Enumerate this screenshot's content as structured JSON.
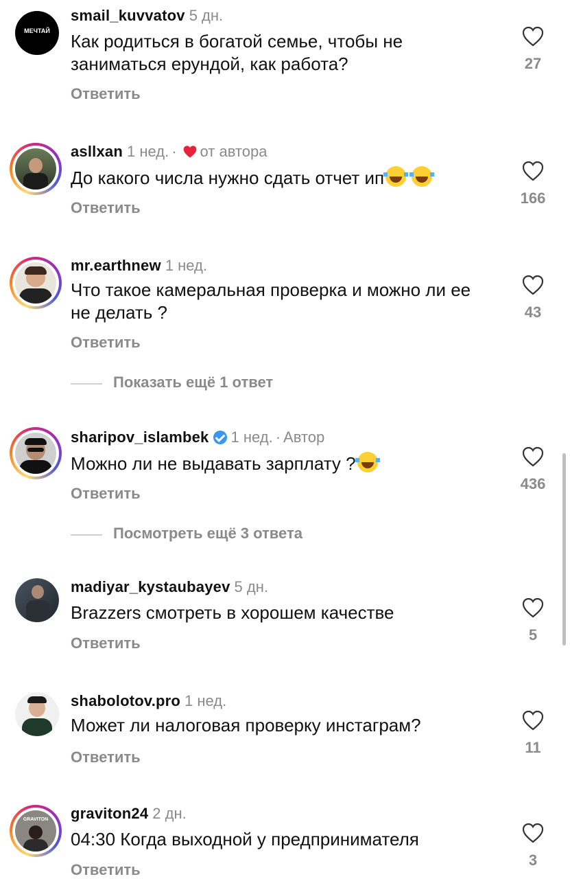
{
  "reply_label": "Ответить",
  "comments": [
    {
      "username": "smail_kuvvatov",
      "time": "5 дн.",
      "text": "Как родиться в богатой семье, чтобы не заниматься ерундой, как работа?",
      "likes": "27",
      "avatar_text": "МЕЧТАЙ"
    },
    {
      "username": "asllxan",
      "time": "1 нед.",
      "badge": "от автора",
      "text": "До какого числа нужно сдать отчет ип",
      "likes": "166"
    },
    {
      "username": "mr.earthnew",
      "time": "1 нед.",
      "text": "Что такое камеральная проверка и можно ли ее не делать ?",
      "likes": "43"
    },
    {
      "username": "sharipov_islambek",
      "time": "1 нед.",
      "badge": "Автор",
      "text": "Можно ли не выдавать зарплату ?",
      "likes": "436"
    },
    {
      "username": "madiyar_kystaubayev",
      "time": "5 дн.",
      "text": "Brazzers смотреть в хорошем качестве",
      "likes": "5"
    },
    {
      "username": "shabolotov.pro",
      "time": "1 нед.",
      "text": "Может ли налоговая проверку инстаграм?",
      "likes": "11"
    },
    {
      "username": "graviton24",
      "time": "2 дн.",
      "text": "04:30 Когда выходной у предпринимателя",
      "likes": "3",
      "avatar_text": "GRAVITON"
    }
  ],
  "more_replies": [
    {
      "label": "Показать ещё 1 ответ"
    },
    {
      "label": "Посмотреть ещё 3 ответа"
    }
  ]
}
